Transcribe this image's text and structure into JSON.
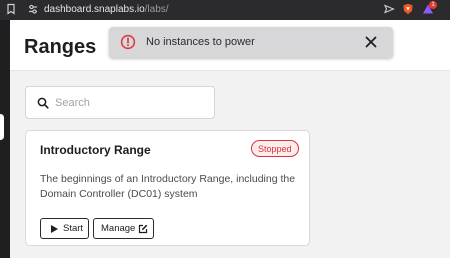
{
  "browser": {
    "url_host": "dashboard.snaplabs.io",
    "url_path": "/labs/",
    "extension_badge": "1"
  },
  "header": {
    "title": "Ranges"
  },
  "toast": {
    "message": "No instances to power"
  },
  "search": {
    "placeholder": "Search",
    "value": ""
  },
  "ranges": [
    {
      "name": "Introductory Range",
      "status": "Stopped",
      "description": "The beginnings of an Introductory Range, including the Domain Controller (DC01) system",
      "actions": {
        "start_label": "Start",
        "manage_label": "Manage"
      }
    }
  ],
  "colors": {
    "status_stopped": "#d9343b",
    "toast_bg": "#d7d7da",
    "alert": "#d9343b"
  }
}
